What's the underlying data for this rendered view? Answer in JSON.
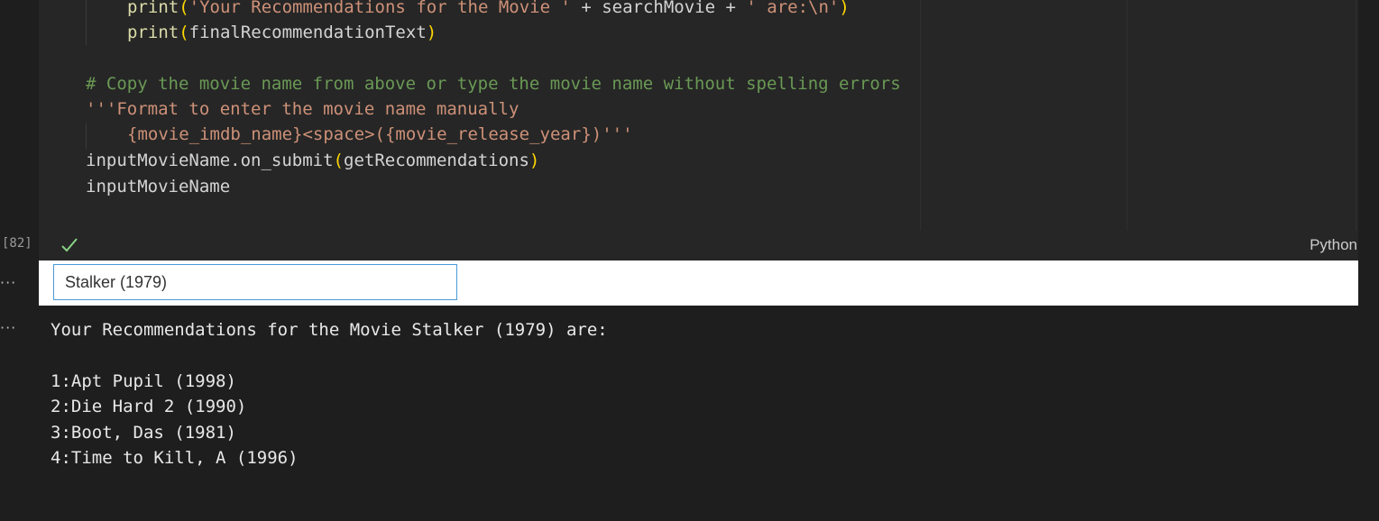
{
  "code": {
    "line1": {
      "fn": "print",
      "str": "'Your Recommendations for the Movie '",
      "var": "searchMovie",
      "str2": "' are:\\n'"
    },
    "line2": {
      "fn": "print",
      "var": "finalRecommendationText"
    },
    "comment": "# Copy the movie name from above or type the movie name without spelling errors",
    "docstring1": "'''Format to enter the movie name manually",
    "docstring2": "{movie_imdb_name}<space>({movie_release_year})'''",
    "line3": {
      "obj": "inputMovieName.on_submit",
      "arg": "getRecommendations"
    },
    "line4": "inputMovieName"
  },
  "cell": {
    "execution_count": "[82]",
    "status_icon": "check-icon",
    "language": "Python"
  },
  "widget": {
    "input_value": "Stalker (1979)"
  },
  "output": {
    "heading": "Your Recommendations for the Movie Stalker (1979) are:",
    "items": [
      "1:Apt Pupil (1998)",
      "2:Die Hard 2 (1990)",
      "3:Boot, Das (1981)",
      "4:Time to Kill, A (1996)"
    ]
  },
  "colors": {
    "editor_bg": "#262626",
    "page_bg": "#1e1e1e",
    "comment": "#6a9955",
    "string": "#ce9178",
    "function": "#dcdcaa",
    "bracket": "#ffd700",
    "input_border": "#4a9ad8"
  }
}
